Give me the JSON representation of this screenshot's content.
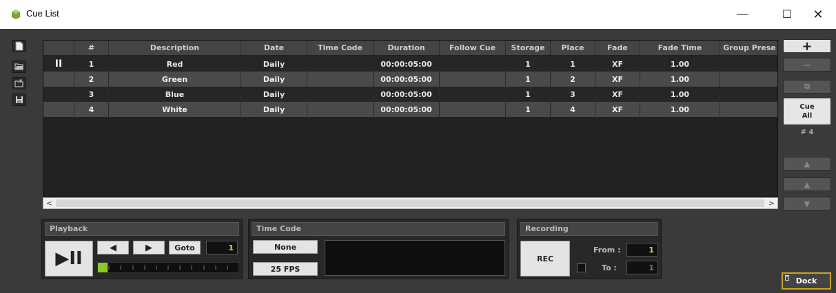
{
  "window": {
    "title": "Cue List",
    "minimize_glyph": "—",
    "maximize_glyph": "☐",
    "close_glyph": "✕"
  },
  "table": {
    "columns": [
      "",
      "#",
      "Description",
      "Date",
      "Time Code",
      "Duration",
      "Follow Cue",
      "Storage",
      "Place",
      "Fade",
      "Fade Time",
      "Group Prese"
    ],
    "rows": [
      {
        "play": "II",
        "num": "1",
        "description": "Red",
        "date": "Daily",
        "time_code": "",
        "duration": "00:00:05:00",
        "follow_cue": "",
        "storage": "1",
        "place": "1",
        "fade": "XF",
        "fade_time": "1.00",
        "group_preset": ""
      },
      {
        "play": "",
        "num": "2",
        "description": "Green",
        "date": "Daily",
        "time_code": "",
        "duration": "00:00:05:00",
        "follow_cue": "",
        "storage": "1",
        "place": "2",
        "fade": "XF",
        "fade_time": "1.00",
        "group_preset": ""
      },
      {
        "play": "",
        "num": "3",
        "description": "Blue",
        "date": "Daily",
        "time_code": "",
        "duration": "00:00:05:00",
        "follow_cue": "",
        "storage": "1",
        "place": "3",
        "fade": "XF",
        "fade_time": "1.00",
        "group_preset": ""
      },
      {
        "play": "",
        "num": "4",
        "description": "White",
        "date": "Daily",
        "time_code": "",
        "duration": "00:00:05:00",
        "follow_cue": "",
        "storage": "1",
        "place": "4",
        "fade": "XF",
        "fade_time": "1.00",
        "group_preset": ""
      }
    ]
  },
  "scrollbar": {
    "left_arrow": "<",
    "right_arrow": ">"
  },
  "right_panel": {
    "add_label": "+",
    "remove_label": "—",
    "copy_label": "⧉",
    "cue_all_line1": "Cue",
    "cue_all_line2": "All",
    "cue_count": "# 4",
    "move_top_label": "▲",
    "move_up_label": "▲",
    "move_down_label": "▼"
  },
  "playback": {
    "header": "Playback",
    "play_pause_label": "▶II",
    "prev_label": "◀",
    "next_label": "▶",
    "goto_label": "Goto",
    "goto_value": "1",
    "progress": 0.07
  },
  "timecode": {
    "header": "Time Code",
    "source_label": "None",
    "fps_label": "25 FPS"
  },
  "recording": {
    "header": "Recording",
    "rec_label": "REC",
    "from_label": "From :",
    "from_value": "1",
    "to_label": "To :",
    "to_value": "1"
  },
  "dock": {
    "label": "Dock"
  },
  "colors": {
    "accent_yellow": "#f2d21e",
    "progress_green": "#8ac926",
    "dock_border": "#c9a227"
  }
}
